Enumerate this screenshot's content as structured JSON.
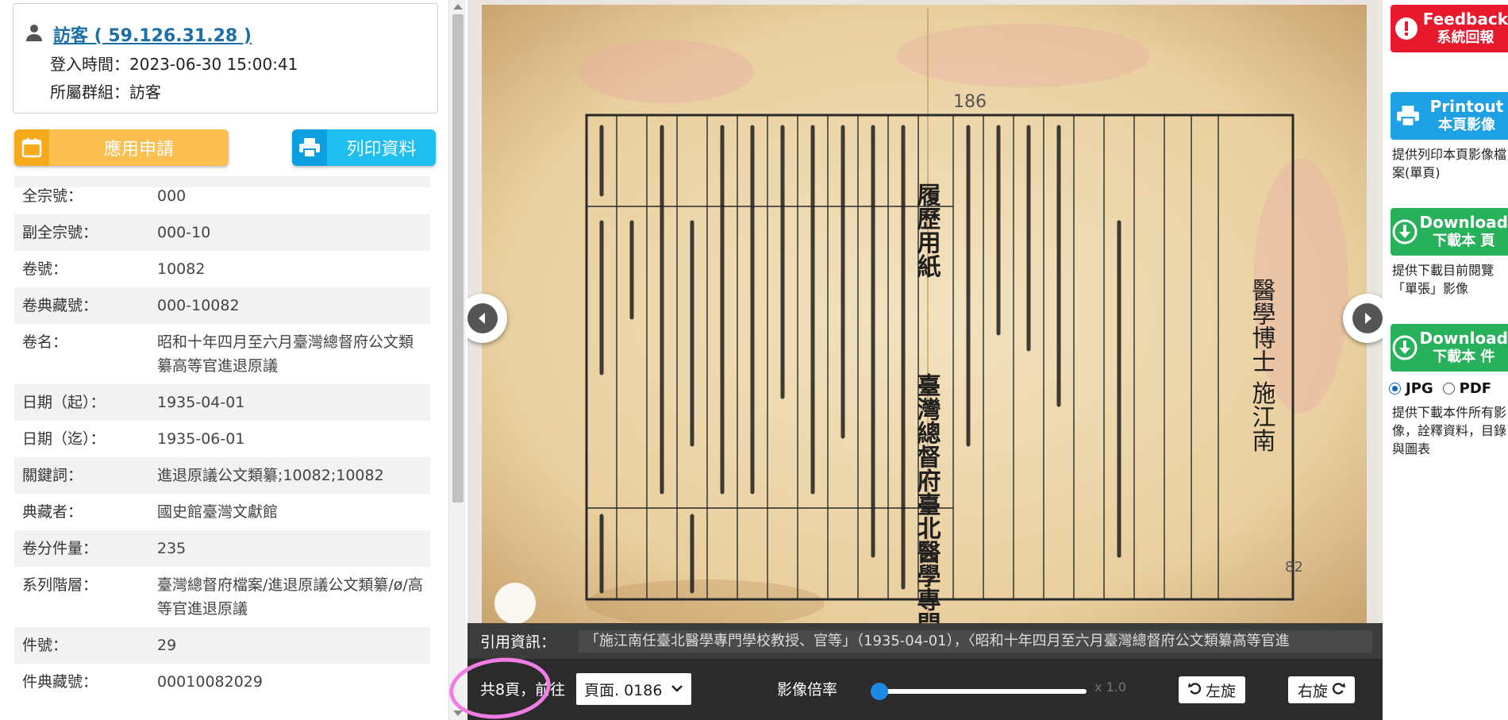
{
  "user": {
    "name": "訪客 ( 59.126.31.28 )",
    "login_time": "登入時間：2023-06-30 15:00:41",
    "group": "所屬群組：訪客"
  },
  "buttons": {
    "apply": "應用申請",
    "print": "列印資料"
  },
  "metadata": [
    {
      "key": "全宗號：",
      "value": "000"
    },
    {
      "key": "副全宗號：",
      "value": "000-10"
    },
    {
      "key": "卷號：",
      "value": "10082"
    },
    {
      "key": "卷典藏號：",
      "value": "000-10082"
    },
    {
      "key": "卷名：",
      "value": "昭和十年四月至六月臺灣總督府公文類纂高等官進退原議"
    },
    {
      "key": "日期（起）：",
      "value": "1935-04-01"
    },
    {
      "key": "日期（迄）：",
      "value": "1935-06-01"
    },
    {
      "key": "關鍵詞：",
      "value": "進退原議公文類纂;10082;10082"
    },
    {
      "key": "典藏者：",
      "value": "國史館臺灣文獻館"
    },
    {
      "key": "卷分件量：",
      "value": "235"
    },
    {
      "key": "系列階層：",
      "value": "臺灣總督府檔案/進退原議公文類纂/ø/高等官進退原議"
    },
    {
      "key": "件號：",
      "value": "29"
    },
    {
      "key": "件典藏號：",
      "value": "00010082029"
    }
  ],
  "viewer": {
    "cite_label": "引用資訊：",
    "cite_text": "「施江南任臺北醫學專門學校教授、官等」（1935-04-01），〈昭和十年四月至六月臺灣總督府公文類纂高等官進",
    "page_count": "共8頁，前往",
    "page_select": "頁面. 0186",
    "zoom_label": "影像倍率",
    "zoom_value": "x 1.0",
    "zoom_fraction": 0.0,
    "rotate_left": "左旋",
    "rotate_right": "右旋"
  },
  "document": {
    "heading": "履歷用紙",
    "school": "臺灣總督府臺北醫學專門學校",
    "person": "醫學博士 施江南",
    "page_mark": "186",
    "page_mark2": "82"
  },
  "side": {
    "feedback_en": "Feedback",
    "feedback_zh": "系統回報",
    "printout_en": "Printout",
    "printout_zh": "本頁影像",
    "printout_desc": "提供列印本頁影像檔案(單頁)",
    "dl_page_en": "Download",
    "dl_page_zh": "下載本 頁",
    "dl_page_desc": "提供下載目前閱覽「單張」影像",
    "dl_item_en": "Download",
    "dl_item_zh": "下載本 件",
    "fmt_jpg": "JPG",
    "fmt_pdf": "PDF",
    "dl_item_desc": "提供下載本件所有影像，詮釋資料，目錄與圖表"
  },
  "colors": {
    "apply": "#fbbf4f",
    "print": "#1ebef0",
    "feedback": "#e8192c",
    "printout": "#1ea1e4",
    "download": "#27b15a",
    "highlight": "#f07de4"
  }
}
